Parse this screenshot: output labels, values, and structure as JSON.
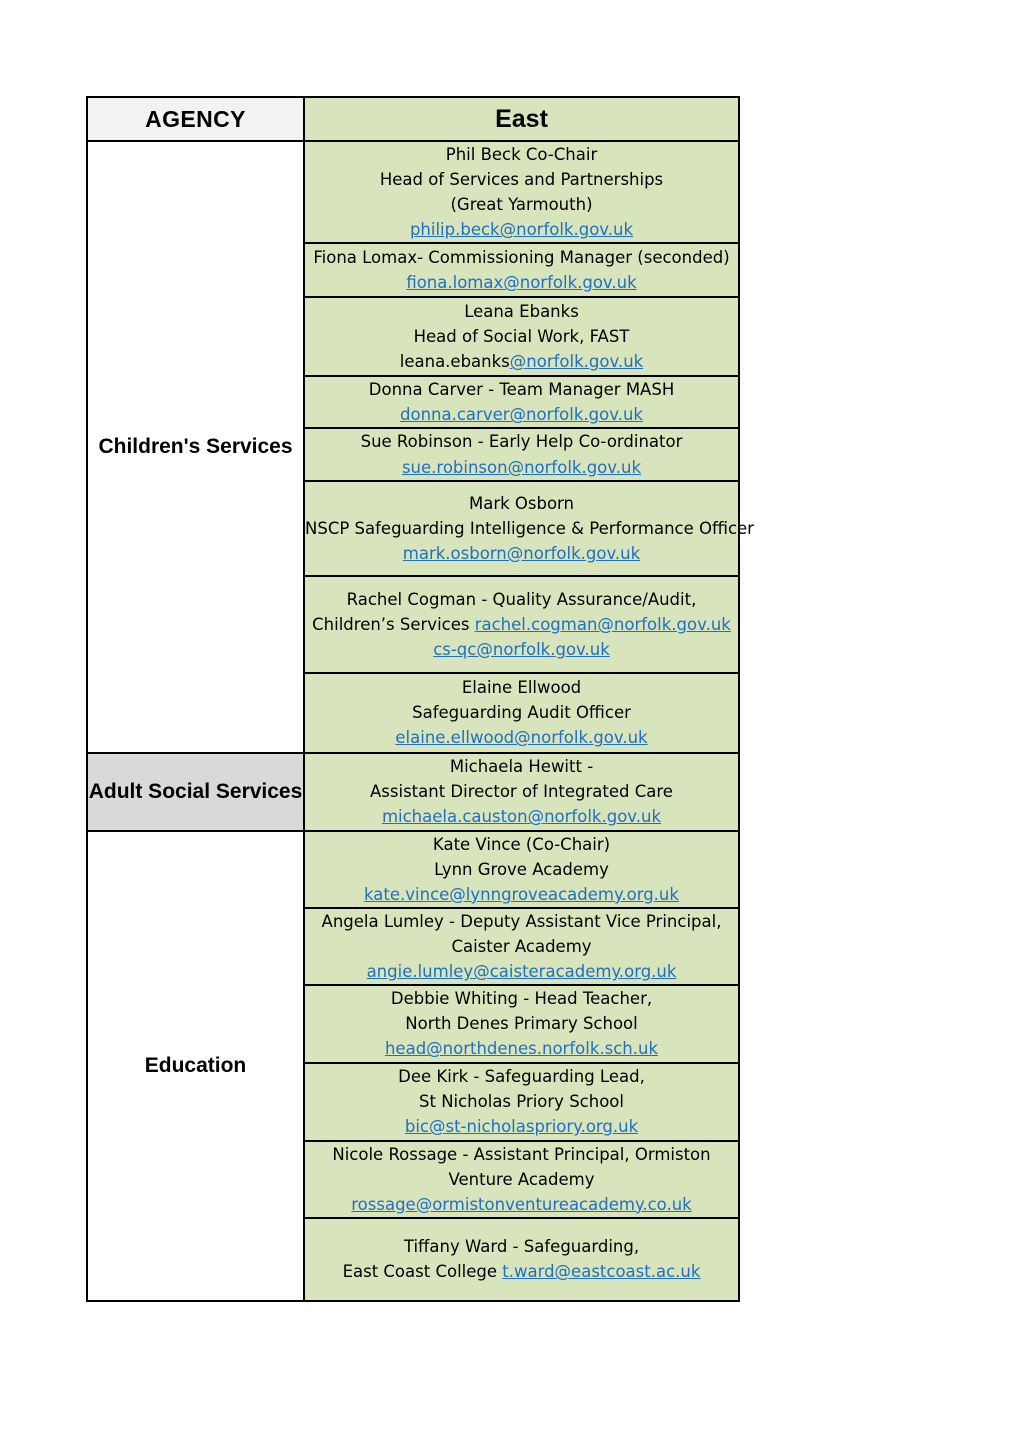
{
  "document": {
    "title": "AGENCY / East contact table",
    "colors": {
      "green_cell": "#d8e4bc",
      "grey_cell": "#d9d9d9",
      "header_grey": "#f2f2f2",
      "link_blue": "#1f6fc4",
      "border": "#000000"
    }
  },
  "table": {
    "headers": {
      "agency": "AGENCY",
      "east": "East"
    },
    "groups": [
      {
        "label": "Children's Services",
        "label_background": "#ffffff",
        "rows": [
          {
            "lines": [
              {
                "text": "Phil Beck Co-Chair",
                "type": "text"
              },
              {
                "text": "Head of Services and Partnerships",
                "type": "text"
              },
              {
                "text": "(Great Yarmouth)",
                "type": "text"
              },
              {
                "text": "philip.beck@norfolk.gov.uk",
                "type": "link"
              }
            ]
          },
          {
            "lines": [
              {
                "text": "Fiona Lomax- Commissioning Manager (seconded)",
                "type": "text"
              },
              {
                "text": "fiona.lomax@norfolk.gov.uk",
                "type": "link"
              }
            ]
          },
          {
            "lines": [
              {
                "text": "Leana Ebanks",
                "type": "text"
              },
              {
                "text": "Head of Social Work, FAST",
                "type": "text"
              },
              {
                "text": "leana.ebanks",
                "type": "text",
                "suffix_link": "@norfolk.gov.uk"
              }
            ]
          },
          {
            "lines": [
              {
                "text": "Donna Carver  -  Team Manager MASH",
                "type": "text"
              },
              {
                "text": "donna.carver@norfolk.gov.uk",
                "type": "link"
              }
            ]
          },
          {
            "lines": [
              {
                "text": "Sue Robinson - Early Help Co-ordinator",
                "type": "text"
              },
              {
                "text": "sue.robinson@norfolk.gov.uk",
                "type": "link"
              }
            ]
          },
          {
            "lines": [
              {
                "text": "Mark Osborn",
                "type": "text"
              },
              {
                "text": "NSCP Safeguarding Intelligence & Performance Officer",
                "type": "text"
              },
              {
                "text": "mark.osborn@norfolk.gov.uk ",
                "type": "link"
              }
            ]
          },
          {
            "lines": [
              {
                "text": "Rachel Cogman - Quality Assurance/Audit, Children’s Services ",
                "type": "text",
                "suffix_link": "rachel.cogman@norfolk.gov.uk"
              },
              {
                "text": "cs-qc@norfolk.gov.uk",
                "type": "link"
              }
            ]
          },
          {
            "lines": [
              {
                "text": "Elaine Ellwood",
                "type": "text"
              },
              {
                "text": "Safeguarding Audit Officer",
                "type": "text"
              },
              {
                "text": "elaine.ellwood@norfolk.gov.uk",
                "type": "link"
              }
            ]
          }
        ]
      },
      {
        "label": "Adult Social Services",
        "label_background": "#d9d9d9",
        "rows": [
          {
            "lines": [
              {
                "text": "Michaela Hewitt -",
                "type": "text"
              },
              {
                "text": "Assistant Director of Integrated Care",
                "type": "text"
              },
              {
                "text": "michaela.causton@norfolk.gov.uk",
                "type": "link"
              }
            ]
          }
        ]
      },
      {
        "label": "Education",
        "label_background": "#ffffff",
        "rows": [
          {
            "lines": [
              {
                "text": "Kate Vince (Co-Chair)",
                "type": "text"
              },
              {
                "text": "Lynn Grove Academy",
                "type": "text"
              },
              {
                "text": "kate.vince@lynngroveacademy.org.uk",
                "type": "link"
              }
            ]
          },
          {
            "lines": [
              {
                "text": "Angela Lumley - Deputy Assistant Vice Principal,",
                "type": "text"
              },
              {
                "text": "Caister Academy",
                "type": "text"
              },
              {
                "text": "angie.lumley@caisteracademy.org.uk",
                "type": "link"
              }
            ]
          },
          {
            "lines": [
              {
                "text": "Debbie Whiting -  Head Teacher,",
                "type": "text"
              },
              {
                "text": "North Denes Primary School",
                "type": "text"
              },
              {
                "text": "head@northdenes.norfolk.sch.uk",
                "type": "link"
              }
            ]
          },
          {
            "lines": [
              {
                "text": "Dee Kirk - Safeguarding Lead,",
                "type": "text"
              },
              {
                "text": "St Nicholas Priory School",
                "type": "text"
              },
              {
                "text": "bic@st-nicholaspriory.org.uk",
                "type": "link"
              }
            ]
          },
          {
            "lines": [
              {
                "text": "Nicole Rossage - Assistant Principal, Ormiston Venture Academy  ",
                "type": "text",
                "suffix_link": "rossage@ormistonventureacademy.co.uk"
              }
            ]
          },
          {
            "lines": [
              {
                "text": "Tiffany Ward - Safeguarding,",
                "type": "text"
              },
              {
                "text": "East Coast College ",
                "type": "text",
                "suffix_link": "t.ward@eastcoast.ac.uk"
              }
            ]
          }
        ]
      }
    ]
  }
}
